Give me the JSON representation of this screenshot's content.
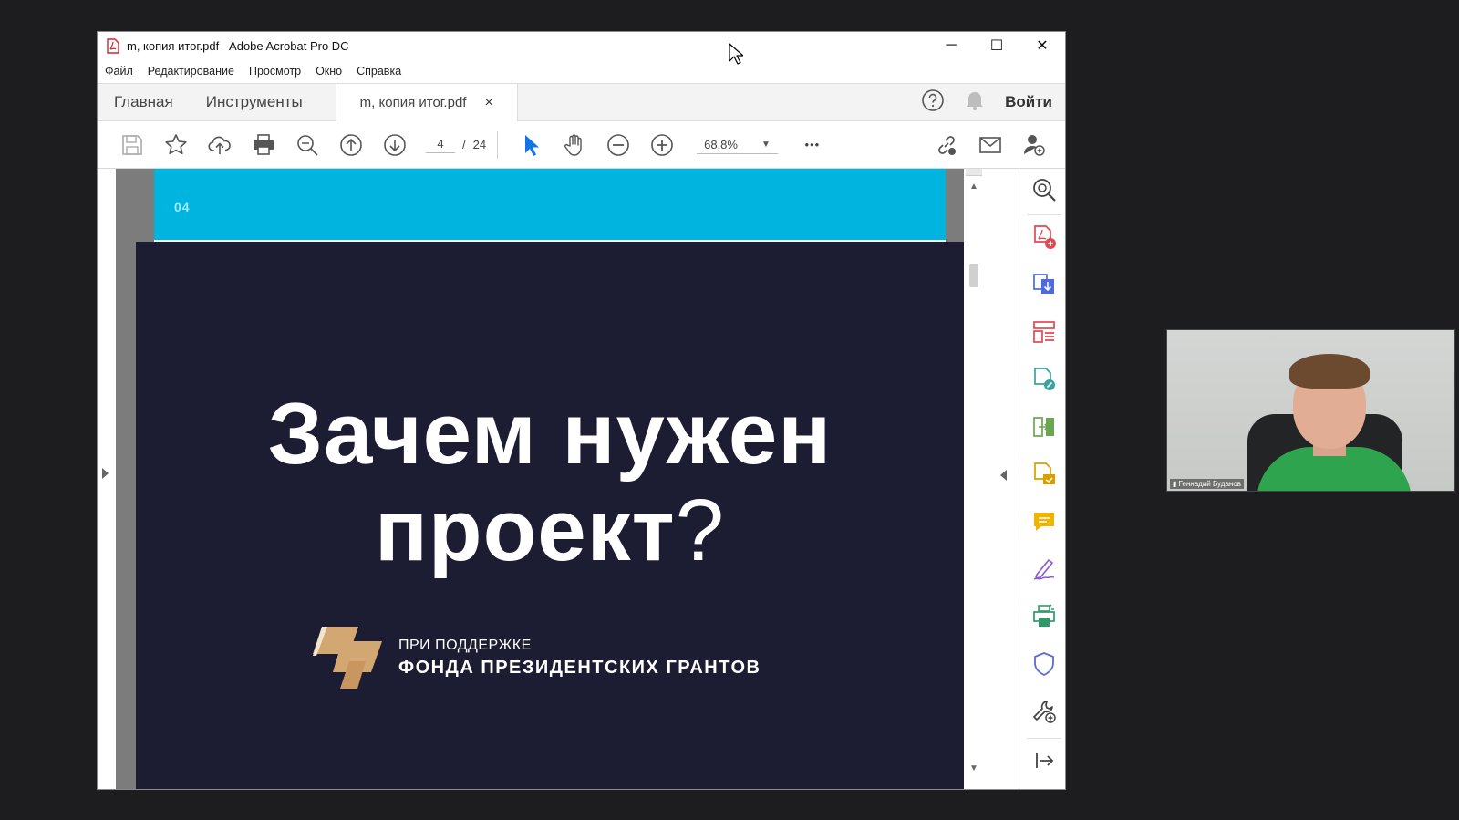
{
  "window": {
    "title": "m, копия итог.pdf - Adobe Acrobat Pro DC",
    "minimize": "─",
    "maximize": "☐",
    "close": "✕"
  },
  "menu": [
    "Файл",
    "Редактирование",
    "Просмотр",
    "Окно",
    "Справка"
  ],
  "tabs": {
    "home": "Главная",
    "tools": "Инструменты",
    "document": "m, копия итог.pdf",
    "document_close": "×",
    "signin": "Войти"
  },
  "toolbar": {
    "current_page": "4",
    "page_separator": "/",
    "total_pages": "24",
    "zoom": "68,8%",
    "more": "•••"
  },
  "document": {
    "page_label": "04",
    "headline_line1": "Зачем нужен",
    "headline_line2": "проект",
    "headline_mark": "?",
    "support_line1": "ПРИ ПОДДЕРЖКЕ",
    "support_line2": "ФОНДА ПРЕЗИДЕНТСКИХ ГРАНТОВ"
  },
  "webcam": {
    "name": "Геннадий Буданов"
  },
  "colors": {
    "cyan_band": "#00b4e0",
    "page_dark": "#1c1c33",
    "canvas_gray": "#7c7c7c",
    "select_blue": "#1473e6",
    "logo_tan": "#d3a771"
  },
  "icons": {
    "toolbar": [
      "save-icon",
      "bookmark-star-icon",
      "upload-cloud-icon",
      "print-icon",
      "zoom-search-icon",
      "page-up-icon",
      "page-down-icon",
      "select-arrow-icon",
      "hand-tool-icon",
      "zoom-out-icon",
      "zoom-in-icon",
      "share-link-icon",
      "email-icon",
      "add-user-icon"
    ],
    "right_panel": [
      "zoom-magnifier-icon",
      "create-pdf-icon",
      "export-pdf-icon",
      "organize-pages-icon",
      "edit-pdf-icon",
      "combine-files-icon",
      "request-signature-icon",
      "comment-icon",
      "fill-sign-icon",
      "print-production-icon",
      "protect-shield-icon",
      "more-tools-icon",
      "collapse-panel-icon"
    ]
  }
}
